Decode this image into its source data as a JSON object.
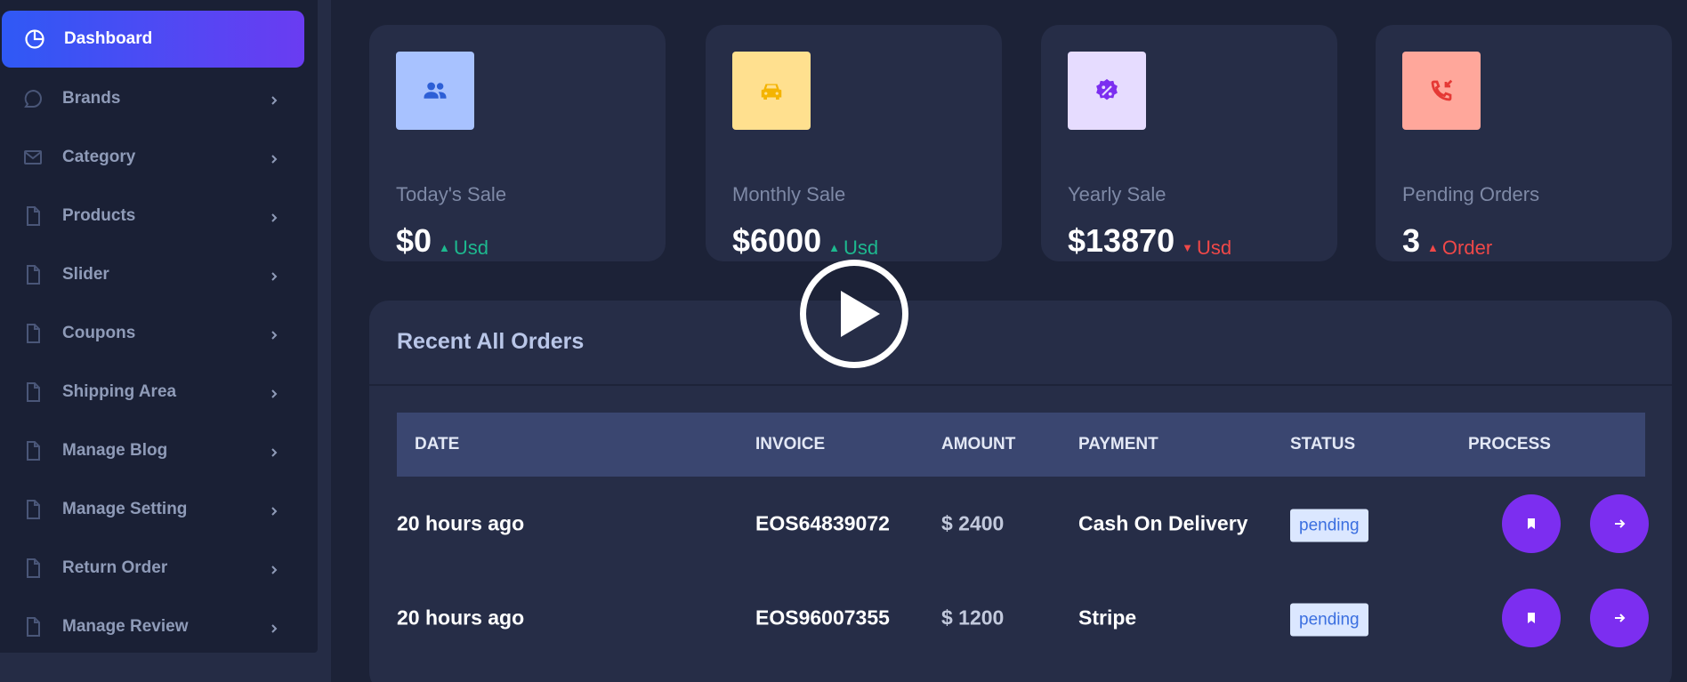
{
  "sidebar": {
    "items": [
      {
        "label": "Dashboard",
        "icon": "pie-chart-icon",
        "active": true
      },
      {
        "label": "Brands",
        "icon": "chat-icon"
      },
      {
        "label": "Category",
        "icon": "mail-icon"
      },
      {
        "label": "Products",
        "icon": "file-icon"
      },
      {
        "label": "Slider",
        "icon": "file-icon"
      },
      {
        "label": "Coupons",
        "icon": "file-icon"
      },
      {
        "label": "Shipping Area",
        "icon": "file-icon"
      },
      {
        "label": "Manage Blog",
        "icon": "file-icon"
      },
      {
        "label": "Manage Setting",
        "icon": "file-icon"
      },
      {
        "label": "Return Order",
        "icon": "file-icon"
      },
      {
        "label": "Manage Review",
        "icon": "file-icon"
      }
    ]
  },
  "stats": [
    {
      "label": "Today's Sale",
      "value": "$0",
      "trend": "Usd",
      "trend_dir": "up",
      "icon": "users-icon",
      "bg": "#a8c2ff",
      "fg": "#2d5fd6"
    },
    {
      "label": "Monthly Sale",
      "value": "$6000",
      "trend": "Usd",
      "trend_dir": "up",
      "icon": "car-icon",
      "bg": "#ffe08f",
      "fg": "#f4b400"
    },
    {
      "label": "Yearly Sale",
      "value": "$13870",
      "trend": "Usd",
      "trend_dir": "down",
      "icon": "discount-icon",
      "bg": "#e6dcff",
      "fg": "#7c2ef0"
    },
    {
      "label": "Pending Orders",
      "value": "3",
      "trend": "Order",
      "trend_dir": "up-red",
      "icon": "phone-incoming-icon",
      "bg": "#ffa79b",
      "fg": "#e53935"
    }
  ],
  "orders": {
    "title": "Recent All Orders",
    "columns": [
      "DATE",
      "INVOICE",
      "AMOUNT",
      "PAYMENT",
      "STATUS",
      "PROCESS"
    ],
    "rows": [
      {
        "date": "20 hours ago",
        "invoice": "EOS64839072",
        "amount": "$ 2400",
        "payment": "Cash On Delivery",
        "status": "pending"
      },
      {
        "date": "20 hours ago",
        "invoice": "EOS96007355",
        "amount": "$ 1200",
        "payment": "Stripe",
        "status": "pending"
      }
    ]
  },
  "colors": {
    "accent": "#7c2ef0",
    "up": "#1db98f",
    "down": "#f04848"
  }
}
